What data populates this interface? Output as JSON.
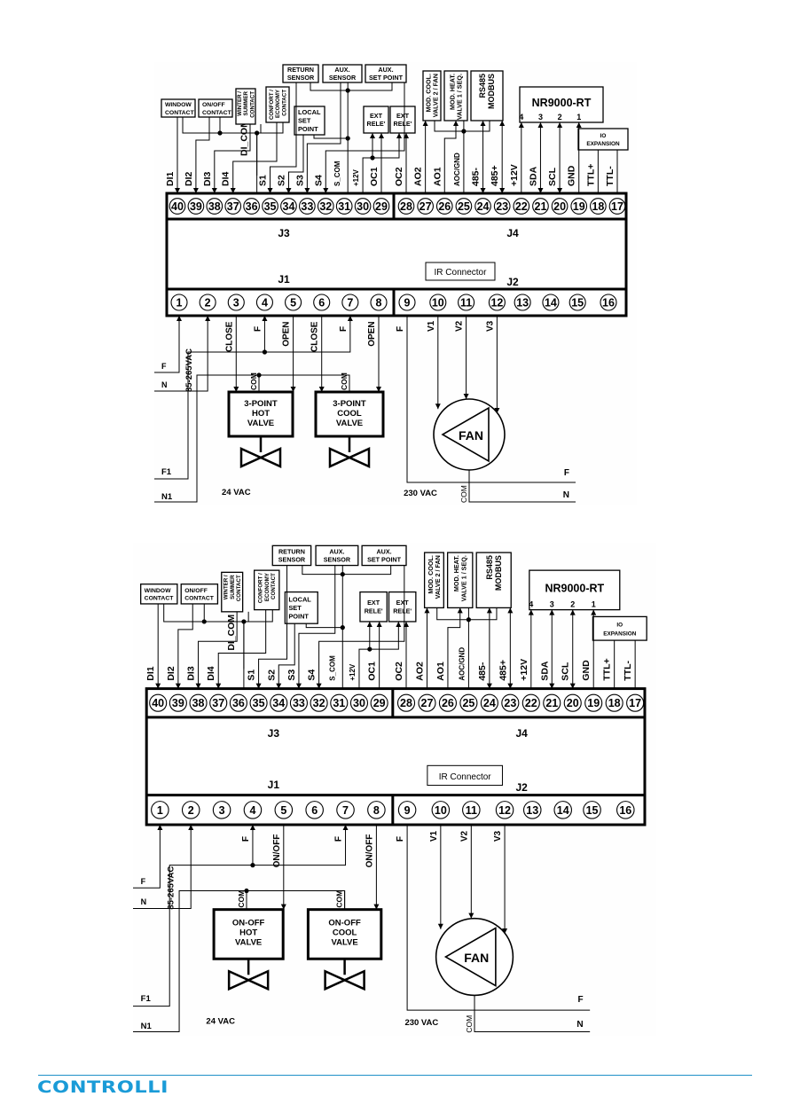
{
  "footer": {
    "brand": "CONTROLLI",
    "accent_color": "#1a9bd7"
  },
  "diagrams": [
    {
      "id": "3-point",
      "top_terminals": [
        "40",
        "39",
        "38",
        "37",
        "36",
        "35",
        "34",
        "33",
        "32",
        "31",
        "30",
        "29",
        "28",
        "27",
        "26",
        "25",
        "24",
        "23",
        "22",
        "21",
        "20",
        "19",
        "18",
        "17"
      ],
      "bottom_terminals": [
        "1",
        "2",
        "3",
        "4",
        "5",
        "6",
        "7",
        "8",
        "9",
        "10",
        "11",
        "12",
        "13",
        "14",
        "15",
        "16"
      ],
      "connector_labels": {
        "j3": "J3",
        "j4": "J4",
        "j1": "J1",
        "j2": "J2",
        "ir": "IR Connector"
      },
      "top_signal_labels": [
        "DI1",
        "DI2",
        "DI3",
        "DI4",
        "DI_COM",
        "S1",
        "S2",
        "S3",
        "S4",
        "S_COM",
        "+12V",
        "OC1",
        "OC2",
        "AO2",
        "AO1",
        "AOC/GND",
        "485-",
        "485+",
        "+12V",
        "SDA",
        "SCL",
        "GND",
        "TTL+",
        "TTL-"
      ],
      "devices_top": {
        "window_contact": [
          "WINDOW",
          "CONTACT"
        ],
        "onoff_contact": [
          "ON/OFF",
          "CONTACT"
        ],
        "winter_summer": [
          "WINTER /",
          "SUMMER",
          "CONTACT"
        ],
        "confort_economy": [
          "CONFORT /",
          "ECONOMY",
          "CONTACT"
        ],
        "return_sensor": [
          "RETURN",
          "SENSOR"
        ],
        "aux_sensor": [
          "AUX.",
          "SENSOR"
        ],
        "aux_set_point": [
          "AUX.",
          "SET POINT"
        ],
        "local_set_point": [
          "LOCAL",
          "SET",
          "POINT"
        ],
        "ext_rele_1": [
          "EXT",
          "RELE'"
        ],
        "ext_rele_2": [
          "EXT",
          "RELE'"
        ],
        "mod_cool": [
          "MOD. COOL.",
          "VALVE 2 / FAN"
        ],
        "mod_heat": [
          "MOD. HEAT.",
          "VALVE 1 / SEQ."
        ],
        "rs485": [
          "RS485",
          "MODBUS"
        ],
        "nr9000": {
          "title": "NR9000-RT",
          "pins": [
            "4",
            "3",
            "2",
            "1"
          ]
        },
        "io_expansion": [
          "IO",
          "EXPANSION"
        ]
      },
      "bottom_signal_labels": {
        "t3": "CLOSE",
        "t4": "F",
        "t5": "OPEN",
        "t6": "CLOSE",
        "t7": "F",
        "t8": "OPEN",
        "t9": "F",
        "t10": "V1",
        "t11": "V2",
        "t12": "V3"
      },
      "supply": {
        "line": "F",
        "neutral": "N",
        "voltage": "85-265VAC"
      },
      "valves": [
        {
          "label": [
            "3-POINT",
            "HOT",
            "VALVE"
          ],
          "com": "COM"
        },
        {
          "label": [
            "3-POINT",
            "COOL",
            "VALVE"
          ],
          "com": "COM"
        }
      ],
      "low_voltage": {
        "line": "F1",
        "neutral": "N1",
        "voltage": "24 VAC"
      },
      "fan": {
        "label": "FAN",
        "com": "COM",
        "line": "F",
        "neutral": "N",
        "voltage": "230 VAC"
      }
    },
    {
      "id": "on-off",
      "top_terminals": [
        "40",
        "39",
        "38",
        "37",
        "36",
        "35",
        "34",
        "33",
        "32",
        "31",
        "30",
        "29",
        "28",
        "27",
        "26",
        "25",
        "24",
        "23",
        "22",
        "21",
        "20",
        "19",
        "18",
        "17"
      ],
      "bottom_terminals": [
        "1",
        "2",
        "3",
        "4",
        "5",
        "6",
        "7",
        "8",
        "9",
        "10",
        "11",
        "12",
        "13",
        "14",
        "15",
        "16"
      ],
      "connector_labels": {
        "j3": "J3",
        "j4": "J4",
        "j1": "J1",
        "j2": "J2",
        "ir": "IR Connector"
      },
      "top_signal_labels": [
        "DI1",
        "DI2",
        "DI3",
        "DI4",
        "DI_COM",
        "S1",
        "S2",
        "S3",
        "S4",
        "S_COM",
        "+12V",
        "OC1",
        "OC2",
        "AO2",
        "AO1",
        "AOC/GND",
        "485-",
        "485+",
        "+12V",
        "SDA",
        "SCL",
        "GND",
        "TTL+",
        "TTL-"
      ],
      "devices_top": {
        "window_contact": [
          "WINDOW",
          "CONTACT"
        ],
        "onoff_contact": [
          "ON/OFF",
          "CONTACT"
        ],
        "winter_summer": [
          "WINTER /",
          "SUMMER",
          "CONTACT"
        ],
        "confort_economy": [
          "CONFORT /",
          "ECONOMY",
          "CONTACT"
        ],
        "return_sensor": [
          "RETURN",
          "SENSOR"
        ],
        "aux_sensor": [
          "AUX.",
          "SENSOR"
        ],
        "aux_set_point": [
          "AUX.",
          "SET POINT"
        ],
        "local_set_point": [
          "LOCAL",
          "SET",
          "POINT"
        ],
        "ext_rele_1": [
          "EXT",
          "RELE'"
        ],
        "ext_rele_2": [
          "EXT",
          "RELE'"
        ],
        "mod_cool": [
          "MOD. COOL.",
          "VALVE 2 / FAN"
        ],
        "mod_heat": [
          "MOD. HEAT.",
          "VALVE 1 / SEQ."
        ],
        "rs485": [
          "RS485",
          "MODBUS"
        ],
        "nr9000": {
          "title": "NR9000-RT",
          "pins": [
            "4",
            "3",
            "2",
            "1"
          ]
        },
        "io_expansion": [
          "IO",
          "EXPANSION"
        ]
      },
      "bottom_signal_labels": {
        "t4": "F",
        "t5": "ON/OFF",
        "t7": "F",
        "t8": "ON/OFF",
        "t9": "F",
        "t10": "V1",
        "t11": "V2",
        "t12": "V3"
      },
      "supply": {
        "line": "F",
        "neutral": "N",
        "voltage": "85-265VAC"
      },
      "valves": [
        {
          "label": [
            "ON-OFF",
            "HOT",
            "VALVE"
          ],
          "com": "COM"
        },
        {
          "label": [
            "ON-OFF",
            "COOL",
            "VALVE"
          ],
          "com": "COM"
        }
      ],
      "low_voltage": {
        "line": "F1",
        "neutral": "N1",
        "voltage": "24 VAC"
      },
      "fan": {
        "label": "FAN",
        "com": "COM",
        "line": "F",
        "neutral": "N",
        "voltage": "230 VAC"
      }
    }
  ]
}
